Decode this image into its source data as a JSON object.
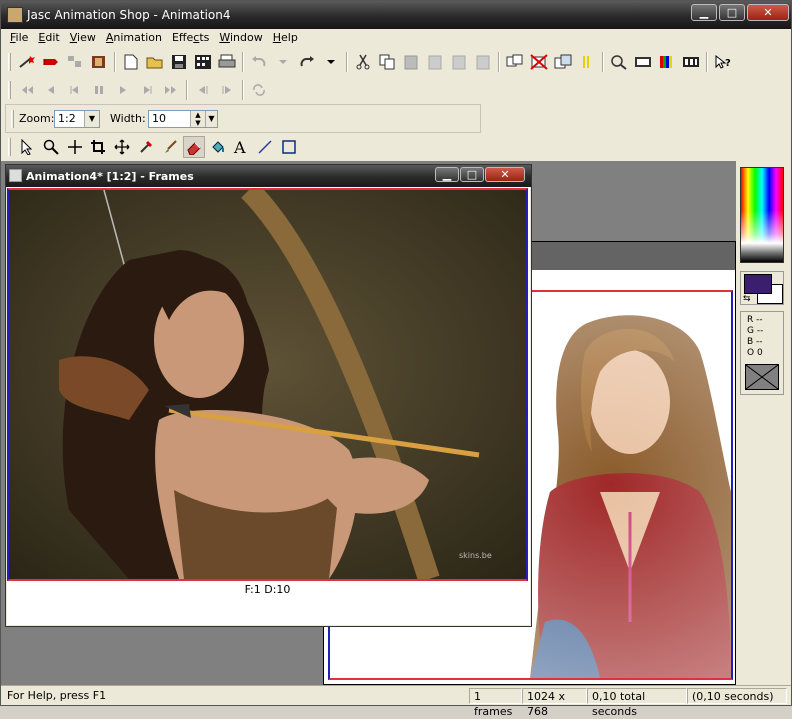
{
  "titlebar": {
    "title": "Jasc Animation Shop - Animation4",
    "min": "▁",
    "max": "□",
    "close": "✕"
  },
  "menu": [
    {
      "pre": "",
      "u": "F",
      "post": "ile"
    },
    {
      "pre": "",
      "u": "E",
      "post": "dit"
    },
    {
      "pre": "",
      "u": "V",
      "post": "iew"
    },
    {
      "pre": "",
      "u": "A",
      "post": "nimation"
    },
    {
      "pre": "Effe",
      "u": "c",
      "post": "ts"
    },
    {
      "pre": "",
      "u": "W",
      "post": "indow"
    },
    {
      "pre": "",
      "u": "H",
      "post": "elp"
    }
  ],
  "zoombar": {
    "zoom_label": "Zoom:",
    "zoom_value": "1:2",
    "width_label": "Width:",
    "width_value": "10"
  },
  "frames_window": {
    "title": "Animation4* [1:2] - Frames",
    "frame_label": "F:1   D:10",
    "watermark": "skins.be",
    "min": "▁",
    "max": "□",
    "close": "✕"
  },
  "rgb": {
    "r": "R --",
    "g": "G --",
    "b": "B --",
    "o": "O  0"
  },
  "colors": {
    "foreground": "#3c1e6e",
    "background": "#ffffff"
  },
  "status": {
    "help": "For Help, press F1",
    "frames": "1 frames",
    "dimensions": "1024 x 768",
    "total": "0,10 total seconds",
    "seconds": "(0,10 seconds)"
  }
}
